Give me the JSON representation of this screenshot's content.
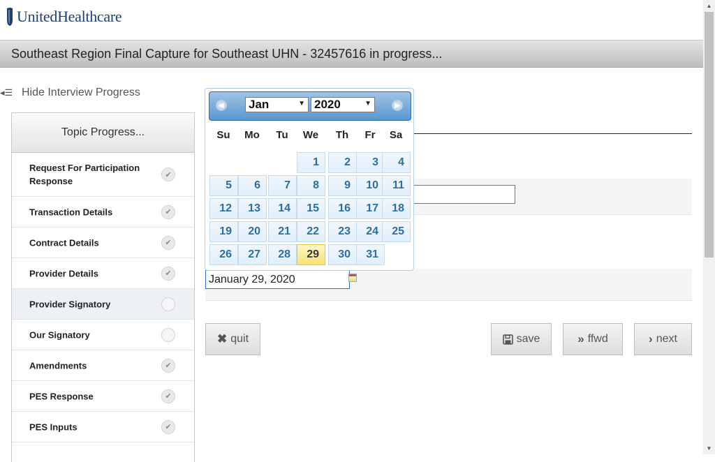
{
  "header": {
    "brand": "UnitedHealthcare",
    "title": "Southeast Region Final Capture for Southeast UHN - 32457616 in progress..."
  },
  "sidebar": {
    "toggle_label": "Hide Interview Progress",
    "toggle_icon": "list-collapse-icon",
    "panel_title": "Topic Progress...",
    "items": [
      {
        "label": "Request For Participation Response",
        "status": "complete"
      },
      {
        "label": "Transaction Details",
        "status": "complete"
      },
      {
        "label": "Contract Details",
        "status": "complete"
      },
      {
        "label": "Provider Details",
        "status": "complete"
      },
      {
        "label": "Provider Signatory",
        "status": "current"
      },
      {
        "label": "Our Signatory",
        "status": "incomplete"
      },
      {
        "label": "Amendments",
        "status": "complete"
      },
      {
        "label": "PES Response",
        "status": "complete"
      },
      {
        "label": "PES Inputs",
        "status": "complete"
      }
    ]
  },
  "form": {
    "date_value": "January 29, 2020"
  },
  "buttons": {
    "quit": "quit",
    "save": "save",
    "ffwd": "ffwd",
    "next": "next"
  },
  "datepicker": {
    "month": "Jan",
    "year": "2020",
    "weekdays": [
      "Su",
      "Mo",
      "Tu",
      "We",
      "Th",
      "Fr",
      "Sa"
    ],
    "first_weekday_index": 3,
    "days_in_month": 31,
    "selected_day": 29
  },
  "colors": {
    "brand": "#1d3f73",
    "calendar_header": "#5a97cf",
    "day_text": "#2e6e9e",
    "selected_day_bg": "#f7e271"
  }
}
